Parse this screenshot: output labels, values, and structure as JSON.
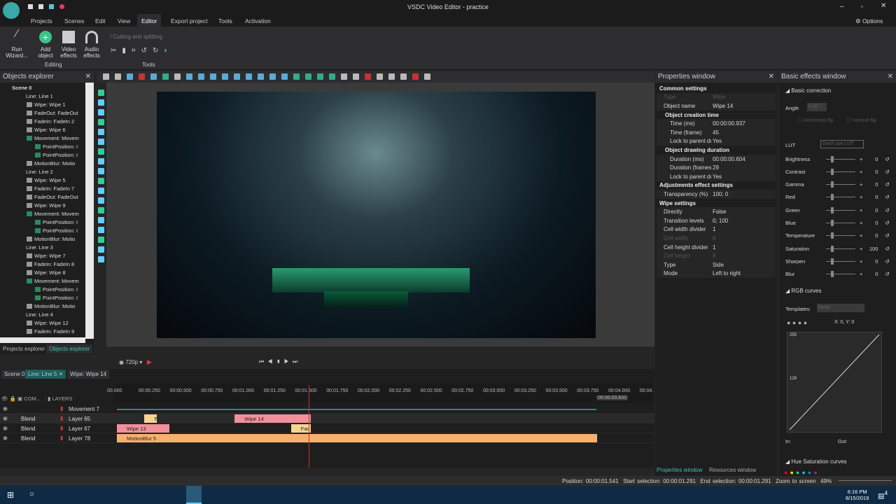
{
  "window": {
    "title": "VSDC Video Editor - practice"
  },
  "menu": [
    "Projects",
    "Scenes",
    "Edit",
    "View",
    "Editor",
    "Export project",
    "Tools",
    "Activation"
  ],
  "window_controls": {
    "options": "Options"
  },
  "ribbon": {
    "run_wizard": "Run Wizard...",
    "add_object": "Add object",
    "video_effects": "Video effects",
    "audio_effects": "Audio effects",
    "editing_group": "Editing",
    "cutting": "Cutting and splitting",
    "tools_group": "Tools"
  },
  "objects_explorer": {
    "title": "Objects explorer",
    "items": [
      {
        "label": "Scene 0",
        "level": 0
      },
      {
        "label": "Line: Line 1",
        "level": 1
      },
      {
        "label": "Wipe: Wipe 1",
        "level": 2
      },
      {
        "label": "FadeOut: FadeOut",
        "level": 2
      },
      {
        "label": "FadeIn: FadeIn 2",
        "level": 2
      },
      {
        "label": "Wipe: Wipe 6",
        "level": 2
      },
      {
        "label": "Movement: Movem",
        "level": 2
      },
      {
        "label": "PointPosition: I",
        "level": 3
      },
      {
        "label": "PointPosition: I",
        "level": 3
      },
      {
        "label": "MotionBlur: Motio",
        "level": 2
      },
      {
        "label": "Line: Line 2",
        "level": 1
      },
      {
        "label": "Wipe: Wipe 5",
        "level": 2
      },
      {
        "label": "FadeIn: FadeIn 7",
        "level": 2
      },
      {
        "label": "FadeOut: FadeOut",
        "level": 2
      },
      {
        "label": "Wipe: Wipe 9",
        "level": 2
      },
      {
        "label": "Movement: Movem",
        "level": 2
      },
      {
        "label": "PointPosition: I",
        "level": 3
      },
      {
        "label": "PointPosition: I",
        "level": 3
      },
      {
        "label": "MotionBlur: Motio",
        "level": 2
      },
      {
        "label": "Line: Line 3",
        "level": 1
      },
      {
        "label": "Wipe: Wipe 7",
        "level": 2
      },
      {
        "label": "FadeIn: FadeIn 8",
        "level": 2
      },
      {
        "label": "Wipe: Wipe 8",
        "level": 2
      },
      {
        "label": "Movement: Movem",
        "level": 2
      },
      {
        "label": "PointPosition: I",
        "level": 3
      },
      {
        "label": "PointPosition: I",
        "level": 3
      },
      {
        "label": "MotionBlur: Motio",
        "level": 2
      },
      {
        "label": "Line: Line 4",
        "level": 1
      },
      {
        "label": "Wipe: Wipe 12",
        "level": 2
      },
      {
        "label": "FadeIn: FadeIn 9",
        "level": 2
      }
    ],
    "tabs": [
      "Projects explorer",
      "Objects explorer"
    ]
  },
  "preview": {
    "quality": "720p"
  },
  "timeline": {
    "tabs": [
      "Scene 0",
      "Line: Line 5",
      "Wipe: Wipe 14"
    ],
    "header": {
      "com": "COM...",
      "layers": "LAYERS"
    },
    "ticks": [
      "00.000",
      "00:00.250",
      "00:00.500",
      "00:00.750",
      "00:01.000",
      "00:01.250",
      "00:01.500",
      "00:01.750",
      "00:02.000",
      "00:02.250",
      "00:02.500",
      "00:02.750",
      "00:03.000",
      "00:03.250",
      "00:03.500",
      "00:03.750",
      "00:04.000",
      "00:04."
    ],
    "end_marker": "00:00:03.833",
    "rows": [
      {
        "blend": "",
        "name": "Movement 7"
      },
      {
        "blend": "Blend",
        "name": "Layer 65"
      },
      {
        "blend": "Blend",
        "name": "Layer 67"
      },
      {
        "blend": "Blend",
        "name": "Layer 78"
      }
    ],
    "clips": [
      {
        "label": "Fa",
        "row": 1,
        "start": 0.22,
        "end": 0.32,
        "color": "#f5d590"
      },
      {
        "label": "Wipe 14",
        "row": 1,
        "start": 0.94,
        "end": 1.55,
        "color": "#f0909a"
      },
      {
        "label": "Wipe 13",
        "row": 2,
        "start": 0.0,
        "end": 0.42,
        "color": "#f0909a"
      },
      {
        "label": "Fac",
        "row": 2,
        "start": 1.39,
        "end": 1.55,
        "color": "#f5d590"
      },
      {
        "label": "MotionBlur 5",
        "row": 3,
        "start": 0.0,
        "end": 3.83,
        "color": "#f5b070"
      }
    ],
    "playhead_s": 1.541
  },
  "properties": {
    "title": "Properties window",
    "rows": [
      {
        "k": "Common settings",
        "v": "",
        "t": "sec",
        "i": 0
      },
      {
        "k": "Type",
        "v": "Wipe",
        "t": "dis",
        "i": 1
      },
      {
        "k": "Object name",
        "v": "Wipe 14",
        "t": "",
        "i": 1
      },
      {
        "k": "Object creation time",
        "v": "",
        "t": "sec",
        "i": 1
      },
      {
        "k": "Time (ms)",
        "v": "00:00:00.937",
        "t": "",
        "i": 2
      },
      {
        "k": "Time (frame)",
        "v": "45",
        "t": "",
        "i": 2
      },
      {
        "k": "Lock to parent dur.",
        "v": "Yes",
        "t": "",
        "i": 2
      },
      {
        "k": "Object drawing duration",
        "v": "",
        "t": "sec",
        "i": 1
      },
      {
        "k": "Duration (ms)",
        "v": "00:00:00.604",
        "t": "",
        "i": 2
      },
      {
        "k": "Duration (frames)",
        "v": "29",
        "t": "",
        "i": 2
      },
      {
        "k": "Lock to parent dur.",
        "v": "Yes",
        "t": "",
        "i": 2
      },
      {
        "k": "Adjustments effect settings",
        "v": "",
        "t": "sec",
        "i": 0
      },
      {
        "k": "Transparency (%)",
        "v": "100; 0",
        "t": "",
        "i": 1
      },
      {
        "k": "Wipe settings",
        "v": "",
        "t": "sec",
        "i": 0
      },
      {
        "k": "Directly",
        "v": "False",
        "t": "",
        "i": 1
      },
      {
        "k": "Transition levels",
        "v": "0; 100",
        "t": "",
        "i": 1
      },
      {
        "k": "Cell width divider",
        "v": "1",
        "t": "",
        "i": 1
      },
      {
        "k": "Cell width",
        "v": "8",
        "t": "dis",
        "i": 1
      },
      {
        "k": "Cell height divider",
        "v": "1",
        "t": "",
        "i": 1
      },
      {
        "k": "Cell height",
        "v": "8",
        "t": "dis",
        "i": 1
      },
      {
        "k": "Type",
        "v": "Side",
        "t": "",
        "i": 1
      },
      {
        "k": "Mode",
        "v": "Left to right",
        "t": "",
        "i": 1
      }
    ],
    "tabs": [
      "Properties window",
      "Resources window"
    ]
  },
  "basic_effects": {
    "title": "Basic effects window",
    "basic_correction": "Basic correction",
    "angle_label": "Angle",
    "angle_value": "0.00 °",
    "hflip": "Horizontal flip",
    "vflip": "Vertical flip",
    "lut_label": "LUT",
    "lut_value": "Don't use LUT",
    "sliders": [
      {
        "k": "Brightness",
        "v": "0"
      },
      {
        "k": "Contrast",
        "v": "0"
      },
      {
        "k": "Gamma",
        "v": "0"
      },
      {
        "k": "Red",
        "v": "0"
      },
      {
        "k": "Green",
        "v": "0"
      },
      {
        "k": "Blue",
        "v": "0"
      },
      {
        "k": "Temperature",
        "v": "0"
      },
      {
        "k": "Saturation",
        "v": "100"
      },
      {
        "k": "Sharpen",
        "v": "0"
      },
      {
        "k": "Blur",
        "v": "0"
      }
    ],
    "rgb_curves": "RGB curves",
    "templates_label": "Templates:",
    "templates_value": "None",
    "xy": "X: 0, Y: 0",
    "curve_top": "255",
    "curve_mid": "128",
    "in_label": "In:",
    "out_label": "Out:",
    "hue_sat": "Hue Saturation curves"
  },
  "status": {
    "position_label": "Position:",
    "position": "00:00:01.541",
    "start_label": "Start selection:",
    "start": "00:00:01.291",
    "end_label": "End selection:",
    "end": "00:00:01.291",
    "zoom_label": "Zoom to screen",
    "zoom": "49%"
  },
  "taskbar": {
    "time": "6:16 PM",
    "date": "8/15/2019",
    "notifications": "4"
  }
}
